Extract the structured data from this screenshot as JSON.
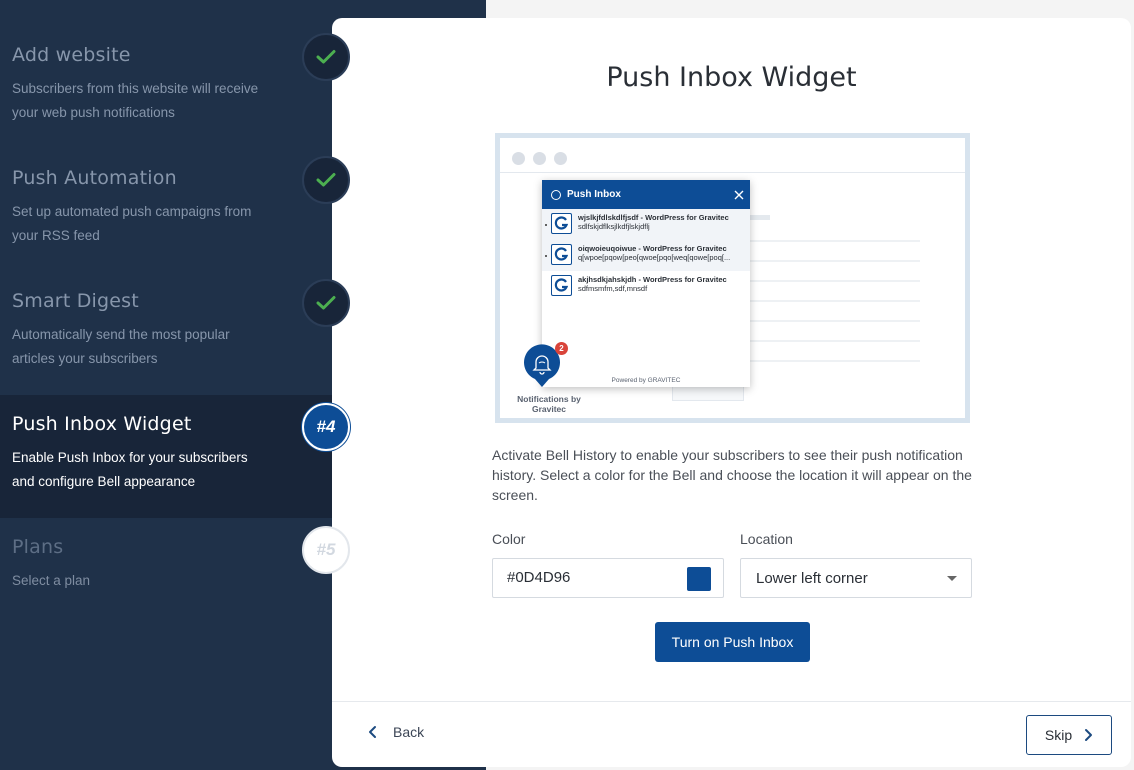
{
  "sidebar": {
    "steps": [
      {
        "title": "Add website",
        "description": "Subscribers from this website will receive your web push notifications",
        "state": "done"
      },
      {
        "title": "Push Automation",
        "description": "Set up automated push campaigns from your RSS feed",
        "state": "done"
      },
      {
        "title": "Smart Digest",
        "description": "Automatically send the most popular articles your subscribers",
        "state": "done"
      },
      {
        "title": "Push Inbox Widget",
        "description": "Enable Push Inbox for your subscribers and configure Bell appearance",
        "state": "active",
        "badge": "#4"
      },
      {
        "title": "Plans",
        "description": "Select a plan",
        "state": "pending",
        "badge": "#5"
      }
    ]
  },
  "main": {
    "title": "Push Inbox Widget",
    "preview": {
      "inbox_title": "Push Inbox",
      "notifications": [
        {
          "title": "wjslkjfdlskdlfjsdf - WordPress for Gravitec",
          "body": "sdlfskjdflksjlkdfjlskjdflj",
          "unread": true
        },
        {
          "title": "oiqwoieuqoiwue - WordPress for Gravitec",
          "body": "q[wpoe[pqow[peo[qwoe[pqo[weq[qowe[poq[...",
          "unread": true
        },
        {
          "title": "akjhsdkjahskjdh - WordPress for Gravitec",
          "body": "sdfmsmfm,sdf,mnsdf",
          "unread": false
        }
      ],
      "powered_by": "Powered by GRAVITEC",
      "bell_count": "2",
      "bell_caption": "Notifications by Gravitec"
    },
    "description": "Activate Bell History to enable your subscribers to see their push notification history. Select a color for the Bell and choose the location it will appear on the screen.",
    "color_label": "Color",
    "color_value": "#0D4D96",
    "location_label": "Location",
    "location_value": "Lower left corner",
    "primary_button": "Turn on Push Inbox"
  },
  "footer": {
    "back_label": "Back",
    "skip_label": "Skip"
  },
  "colors": {
    "sidebar_bg": "#1f3149",
    "active_step_bg": "#182539",
    "accent": "#0d4d96",
    "check_green": "#4caf50",
    "bell_badge": "#d9443a"
  }
}
